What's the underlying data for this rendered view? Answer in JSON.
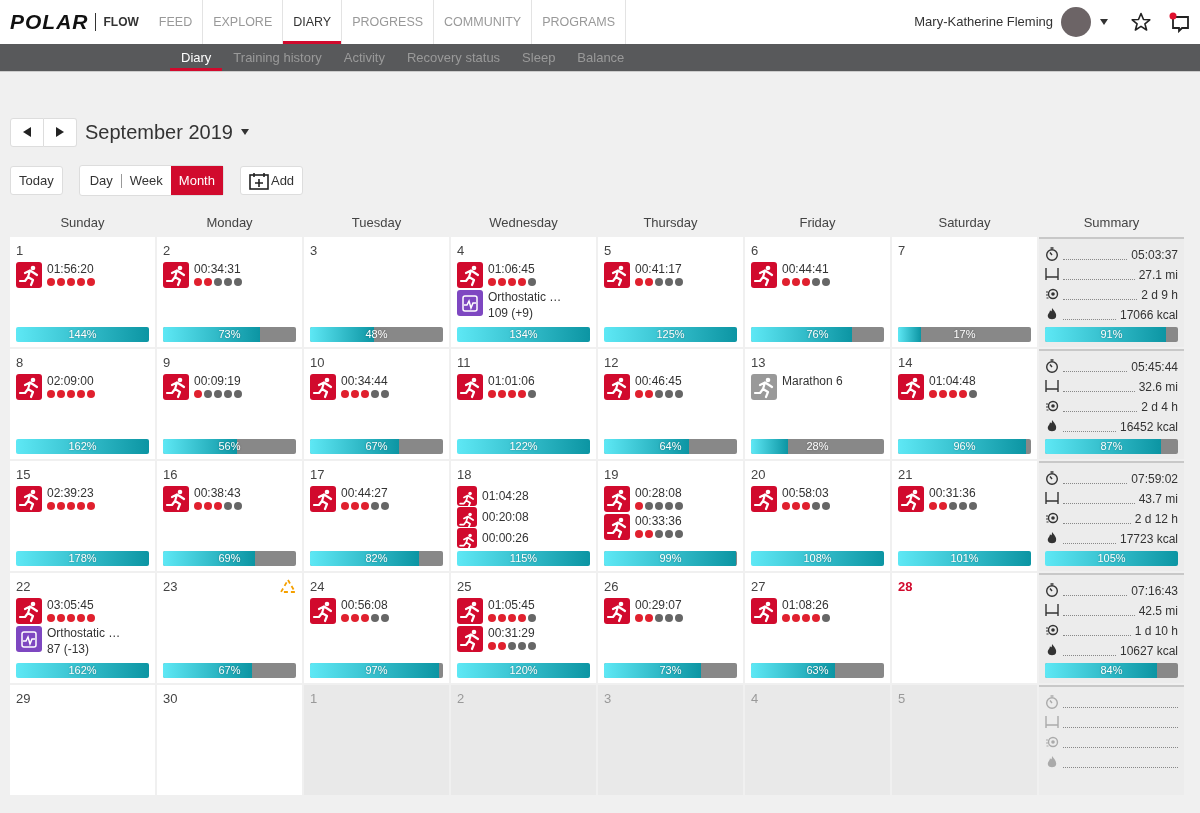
{
  "header": {
    "logo": "POLAR",
    "app": "FLOW",
    "nav": [
      {
        "label": "FEED",
        "selected": false
      },
      {
        "label": "EXPLORE",
        "selected": false
      },
      {
        "label": "DIARY",
        "selected": true
      },
      {
        "label": "PROGRESS",
        "selected": false
      },
      {
        "label": "COMMUNITY",
        "selected": false
      },
      {
        "label": "PROGRAMS",
        "selected": false
      }
    ],
    "user": "Mary-Katherine Fleming",
    "notification": true
  },
  "subnav": [
    {
      "label": "Diary",
      "selected": true
    },
    {
      "label": "Training history",
      "selected": false
    },
    {
      "label": "Activity",
      "selected": false
    },
    {
      "label": "Recovery status",
      "selected": false
    },
    {
      "label": "Sleep",
      "selected": false
    },
    {
      "label": "Balance",
      "selected": false
    }
  ],
  "toolbar": {
    "month": "September 2019",
    "today": "Today",
    "views": [
      {
        "label": "Day",
        "selected": false
      },
      {
        "label": "Week",
        "selected": false
      },
      {
        "label": "Month",
        "selected": true
      }
    ],
    "add": "Add"
  },
  "weekdays": [
    "Sunday",
    "Monday",
    "Tuesday",
    "Wednesday",
    "Thursday",
    "Friday",
    "Saturday"
  ],
  "summary_heading": "Summary",
  "weeks": [
    {
      "days": [
        {
          "day": "1",
          "other_month": false,
          "today": false,
          "alert": false,
          "entries": [
            {
              "kind": "training",
              "time": "01:56:20",
              "stars": 5
            }
          ],
          "activity": {
            "level": 1,
            "reading": "144%"
          }
        },
        {
          "day": "2",
          "other_month": false,
          "today": false,
          "alert": false,
          "entries": [
            {
              "kind": "training",
              "time": "00:34:31",
              "stars": 2
            }
          ],
          "activity": {
            "level": 0.73,
            "reading": "73%"
          }
        },
        {
          "day": "3",
          "other_month": false,
          "today": false,
          "alert": false,
          "activity": {
            "level": 0.48,
            "reading": "48%"
          }
        },
        {
          "day": "4",
          "other_month": false,
          "today": false,
          "alert": false,
          "entries": [
            {
              "kind": "training",
              "time": "01:06:45",
              "stars": 4
            },
            {
              "kind": "test",
              "name": "Orthostatic …",
              "value": "109 (+9)"
            }
          ],
          "activity": {
            "level": 1,
            "reading": "134%"
          }
        },
        {
          "day": "5",
          "other_month": false,
          "today": false,
          "alert": false,
          "entries": [
            {
              "kind": "training",
              "time": "00:41:17",
              "stars": 2
            }
          ],
          "activity": {
            "level": 1,
            "reading": "125%"
          }
        },
        {
          "day": "6",
          "other_month": false,
          "today": false,
          "alert": false,
          "entries": [
            {
              "kind": "training",
              "time": "00:44:41",
              "stars": 3
            }
          ],
          "activity": {
            "level": 0.76,
            "reading": "76%"
          }
        },
        {
          "day": "7",
          "other_month": false,
          "today": false,
          "alert": false,
          "activity": {
            "level": 0.17,
            "reading": "17%"
          }
        }
      ],
      "summary": {
        "disabled": false,
        "rows": [
          {
            "kind": "duration",
            "value": "05:03:37"
          },
          {
            "kind": "distance",
            "value": "27.1 mi"
          },
          {
            "kind": "recovery",
            "value": "2 d 9 h"
          },
          {
            "kind": "calories",
            "value": "17066 kcal"
          }
        ],
        "activity": {
          "level": 0.91,
          "reading": "91%"
        }
      }
    },
    {
      "days": [
        {
          "day": "8",
          "other_month": false,
          "today": false,
          "alert": false,
          "entries": [
            {
              "kind": "training",
              "time": "02:09:00",
              "stars": 5
            }
          ],
          "activity": {
            "level": 1,
            "reading": "162%"
          }
        },
        {
          "day": "9",
          "other_month": false,
          "today": false,
          "alert": false,
          "entries": [
            {
              "kind": "training",
              "time": "00:09:19",
              "stars": 1
            }
          ],
          "activity": {
            "level": 0.56,
            "reading": "56%"
          }
        },
        {
          "day": "10",
          "other_month": false,
          "today": false,
          "alert": false,
          "entries": [
            {
              "kind": "training",
              "time": "00:34:44",
              "stars": 3
            }
          ],
          "activity": {
            "level": 0.67,
            "reading": "67%"
          }
        },
        {
          "day": "11",
          "other_month": false,
          "today": false,
          "alert": false,
          "entries": [
            {
              "kind": "training",
              "time": "01:01:06",
              "stars": 4
            }
          ],
          "activity": {
            "level": 1,
            "reading": "122%"
          }
        },
        {
          "day": "12",
          "other_month": false,
          "today": false,
          "alert": false,
          "entries": [
            {
              "kind": "training",
              "time": "00:46:45",
              "stars": 2
            }
          ],
          "activity": {
            "level": 0.64,
            "reading": "64%"
          }
        },
        {
          "day": "13",
          "other_month": false,
          "today": false,
          "alert": false,
          "entries": [
            {
              "kind": "planned",
              "name": "Marathon 6"
            }
          ],
          "activity": {
            "level": 0.28,
            "reading": "28%"
          }
        },
        {
          "day": "14",
          "other_month": false,
          "today": false,
          "alert": false,
          "entries": [
            {
              "kind": "training",
              "time": "01:04:48",
              "stars": 4
            }
          ],
          "activity": {
            "level": 0.96,
            "reading": "96%"
          }
        }
      ],
      "summary": {
        "disabled": false,
        "rows": [
          {
            "kind": "duration",
            "value": "05:45:44"
          },
          {
            "kind": "distance",
            "value": "32.6 mi"
          },
          {
            "kind": "recovery",
            "value": "2 d 4 h"
          },
          {
            "kind": "calories",
            "value": "16452 kcal"
          }
        ],
        "activity": {
          "level": 0.87,
          "reading": "87%"
        }
      }
    },
    {
      "days": [
        {
          "day": "15",
          "other_month": false,
          "today": false,
          "alert": false,
          "entries": [
            {
              "kind": "training",
              "time": "02:39:23",
              "stars": 5
            }
          ],
          "activity": {
            "level": 1,
            "reading": "178%"
          }
        },
        {
          "day": "16",
          "other_month": false,
          "today": false,
          "alert": false,
          "entries": [
            {
              "kind": "training",
              "time": "00:38:43",
              "stars": 3
            }
          ],
          "activity": {
            "level": 0.69,
            "reading": "69%"
          }
        },
        {
          "day": "17",
          "other_month": false,
          "today": false,
          "alert": false,
          "entries": [
            {
              "kind": "training",
              "time": "00:44:27",
              "stars": 3
            }
          ],
          "activity": {
            "level": 0.82,
            "reading": "82%"
          }
        },
        {
          "day": "18",
          "other_month": false,
          "today": false,
          "alert": false,
          "entries": [
            {
              "kind": "session",
              "time": "01:04:28"
            },
            {
              "kind": "session",
              "time": "00:20:08"
            },
            {
              "kind": "session",
              "time": "00:00:26"
            }
          ],
          "activity": {
            "level": 1,
            "reading": "115%"
          }
        },
        {
          "day": "19",
          "other_month": false,
          "today": false,
          "alert": false,
          "entries": [
            {
              "kind": "training",
              "time": "00:28:08",
              "stars": 1
            },
            {
              "kind": "training",
              "time": "00:33:36",
              "stars": 2
            }
          ],
          "activity": {
            "level": 0.99,
            "reading": "99%"
          }
        },
        {
          "day": "20",
          "other_month": false,
          "today": false,
          "alert": false,
          "entries": [
            {
              "kind": "training",
              "time": "00:58:03",
              "stars": 3
            }
          ],
          "activity": {
            "level": 1,
            "reading": "108%"
          }
        },
        {
          "day": "21",
          "other_month": false,
          "today": false,
          "alert": false,
          "entries": [
            {
              "kind": "training",
              "time": "00:31:36",
              "stars": 2
            }
          ],
          "activity": {
            "level": 1,
            "reading": "101%"
          }
        }
      ],
      "summary": {
        "disabled": false,
        "rows": [
          {
            "kind": "duration",
            "value": "07:59:02"
          },
          {
            "kind": "distance",
            "value": "43.7 mi"
          },
          {
            "kind": "recovery",
            "value": "2 d 12 h"
          },
          {
            "kind": "calories",
            "value": "17723 kcal"
          }
        ],
        "activity": {
          "level": 1,
          "reading": "105%"
        }
      }
    },
    {
      "days": [
        {
          "day": "22",
          "other_month": false,
          "today": false,
          "alert": false,
          "entries": [
            {
              "kind": "training",
              "time": "03:05:45",
              "stars": 5
            },
            {
              "kind": "test",
              "name": "Orthostatic …",
              "value": "87 (-13)"
            }
          ],
          "activity": {
            "level": 1,
            "reading": "162%"
          }
        },
        {
          "day": "23",
          "other_month": false,
          "today": false,
          "alert": true,
          "activity": {
            "level": 0.67,
            "reading": "67%"
          }
        },
        {
          "day": "24",
          "other_month": false,
          "today": false,
          "alert": false,
          "entries": [
            {
              "kind": "training",
              "time": "00:56:08",
              "stars": 3
            }
          ],
          "activity": {
            "level": 0.97,
            "reading": "97%"
          }
        },
        {
          "day": "25",
          "other_month": false,
          "today": false,
          "alert": false,
          "entries": [
            {
              "kind": "training",
              "time": "01:05:45",
              "stars": 4
            },
            {
              "kind": "training",
              "time": "00:31:29",
              "stars": 2
            }
          ],
          "activity": {
            "level": 1,
            "reading": "120%"
          }
        },
        {
          "day": "26",
          "other_month": false,
          "today": false,
          "alert": false,
          "entries": [
            {
              "kind": "training",
              "time": "00:29:07",
              "stars": 2
            }
          ],
          "activity": {
            "level": 0.73,
            "reading": "73%"
          }
        },
        {
          "day": "27",
          "other_month": false,
          "today": false,
          "alert": false,
          "entries": [
            {
              "kind": "training",
              "time": "01:08:26",
              "stars": 4
            }
          ],
          "activity": {
            "level": 0.63,
            "reading": "63%"
          }
        },
        {
          "day": "28",
          "other_month": false,
          "today": true,
          "alert": false
        }
      ],
      "summary": {
        "disabled": false,
        "rows": [
          {
            "kind": "duration",
            "value": "07:16:43"
          },
          {
            "kind": "distance",
            "value": "42.5 mi"
          },
          {
            "kind": "recovery",
            "value": "1 d 10 h"
          },
          {
            "kind": "calories",
            "value": "10627 kcal"
          }
        ],
        "activity": {
          "level": 0.84,
          "reading": "84%"
        }
      }
    },
    {
      "days": [
        {
          "day": "29",
          "other_month": false,
          "today": false,
          "alert": false
        },
        {
          "day": "30",
          "other_month": false,
          "today": false,
          "alert": false
        },
        {
          "day": "1",
          "other_month": true,
          "today": false,
          "alert": false
        },
        {
          "day": "2",
          "other_month": true,
          "today": false,
          "alert": false
        },
        {
          "day": "3",
          "other_month": true,
          "today": false,
          "alert": false
        },
        {
          "day": "4",
          "other_month": true,
          "today": false,
          "alert": false
        },
        {
          "day": "5",
          "other_month": true,
          "today": false,
          "alert": false
        }
      ],
      "summary": {
        "disabled": true,
        "rows": [
          {
            "kind": "duration"
          },
          {
            "kind": "distance"
          },
          {
            "kind": "recovery"
          },
          {
            "kind": "calories"
          }
        ]
      }
    }
  ]
}
